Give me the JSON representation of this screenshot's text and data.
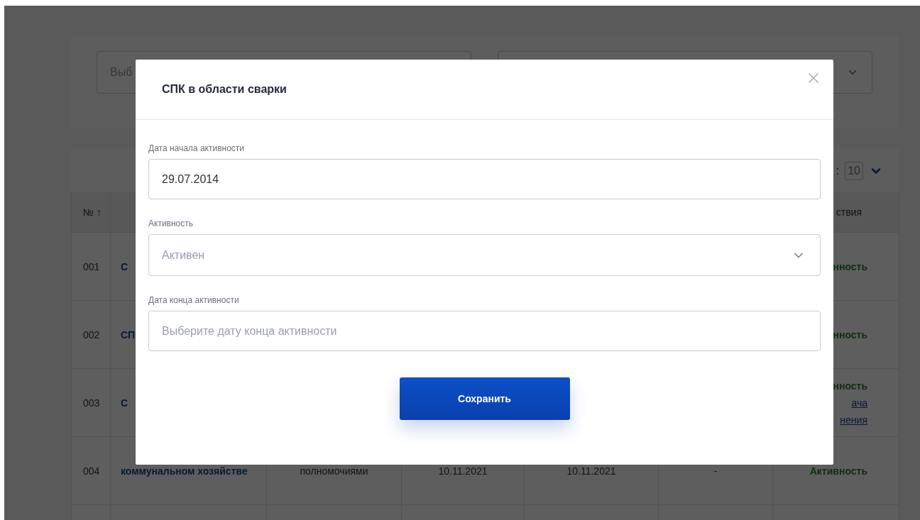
{
  "background": {
    "filters": [
      {
        "kind": "input",
        "placeholder": "Выб"
      },
      {
        "kind": "select"
      }
    ],
    "page_size": {
      "label": ":",
      "value": "10"
    },
    "table": {
      "header": {
        "column_1": "№ ↑",
        "column_7": "ствия"
      },
      "rows": [
        {
          "column_1": "001",
          "column_2": "С",
          "column_7": [
            {
              "kind": "status",
              "text": "нность"
            }
          ]
        },
        {
          "column_1": "002",
          "column_2": "СП",
          "column_7": [
            {
              "kind": "status",
              "text": "нность"
            }
          ]
        },
        {
          "column_1": "003",
          "column_2": "С",
          "column_7": [
            {
              "kind": "status",
              "text": "нность"
            },
            {
              "kind": "link",
              "text": "ача"
            },
            {
              "kind": "link",
              "text": "нения"
            }
          ]
        },
        {
          "column_1": "004",
          "column_2": "коммунальном хозяйстве",
          "column_3": "полномочиями",
          "column_4": "10.11.2021",
          "column_5": "10.11.2021",
          "column_6": "-",
          "column_7": [
            {
              "kind": "status",
              "text": "Активность"
            }
          ]
        }
      ]
    }
  },
  "modal": {
    "title": "СПК в области сварки",
    "fields": [
      {
        "kind": "date",
        "label": "Дата начала активности",
        "value": "29.07.2014"
      },
      {
        "kind": "select",
        "label": "Активность",
        "value": "Активен"
      },
      {
        "kind": "date",
        "label": "Дата конца активности",
        "placeholder": "Выберите дату конца активности"
      }
    ],
    "button": "Сохранить"
  }
}
